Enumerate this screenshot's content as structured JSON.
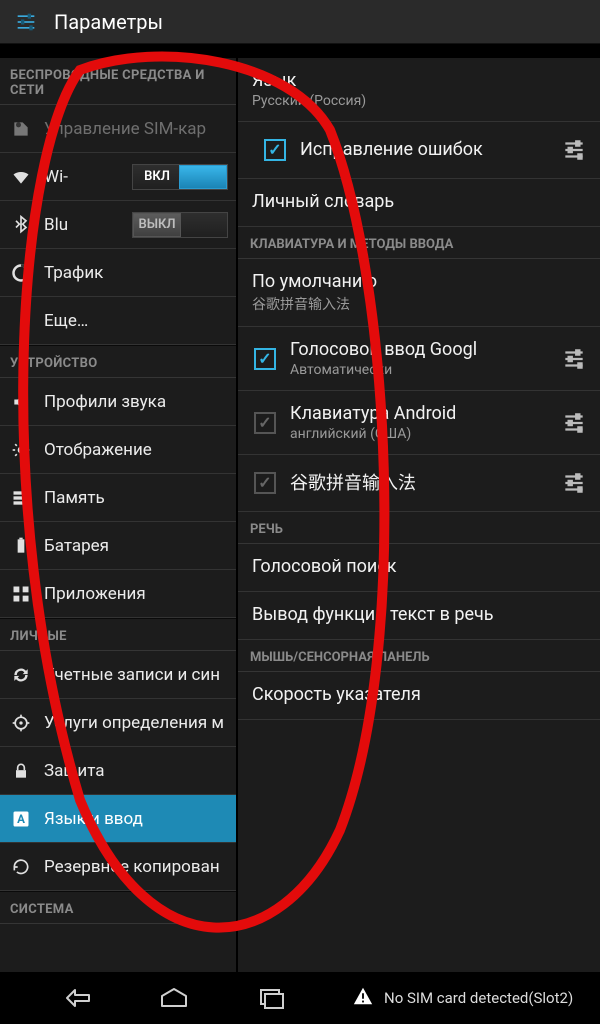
{
  "appbar": {
    "title": "Параметры"
  },
  "left": {
    "sections": [
      {
        "header": "БЕСПРОВОДНЫЕ СРЕДСТВА И СЕТИ",
        "items": [
          {
            "label": "Управление SIM-кар",
            "dim": true
          },
          {
            "label": "Wi-",
            "toggle": {
              "on": true,
              "text": "ВКЛ"
            }
          },
          {
            "label": "Blu",
            "toggle": {
              "on": false,
              "text": "ВЫКЛ"
            }
          },
          {
            "label": "Трафик"
          },
          {
            "label": "Еще…"
          }
        ]
      },
      {
        "header": "УСТРОЙСТВО",
        "items": [
          {
            "label": "Профили звука"
          },
          {
            "label": "Отображение"
          },
          {
            "label": "Память"
          },
          {
            "label": "Батарея"
          },
          {
            "label": "Приложения"
          }
        ]
      },
      {
        "header": "ЛИЧНЫЕ",
        "items": [
          {
            "label": "Учетные записи и син"
          },
          {
            "label": "Услуги определения м"
          },
          {
            "label": "Защита"
          },
          {
            "label": "Язык и ввод",
            "selected": true
          },
          {
            "label": "Резервное копирован"
          }
        ]
      },
      {
        "header": "СИСТЕМА",
        "items": []
      }
    ]
  },
  "right": {
    "language": {
      "title": "Язык",
      "sub": "Русский (Россия)"
    },
    "spellcheck": {
      "label": "Исправление ошибок",
      "checked": true
    },
    "personal_dict": {
      "title": "Личный словарь"
    },
    "kb_header": "КЛАВИАТУРА И МЕТОДЫ ВВОДА",
    "default_kb": {
      "title": "По умолчанию",
      "sub": "谷歌拼音输入法"
    },
    "inputs": [
      {
        "title": "Голосовой ввод Googl",
        "sub": "Автоматически",
        "checked": true,
        "dim": false
      },
      {
        "title": "Клавиатура Android",
        "sub": "английский (США)",
        "checked": true,
        "dim": true
      },
      {
        "title": "谷歌拼音输入法",
        "sub": "",
        "checked": true,
        "dim": true
      }
    ],
    "speech_header": "РЕЧЬ",
    "voice_search": {
      "title": "Голосовой поиск"
    },
    "tts": {
      "title": "Вывод функции текст в речь"
    },
    "mouse_header": "МЫШЬ/СЕНСОРНАЯ ПАНЕЛЬ",
    "pointer_speed": {
      "title": "Скорость указателя"
    }
  },
  "navbar": {
    "status": "No SIM card detected(Slot2)"
  }
}
